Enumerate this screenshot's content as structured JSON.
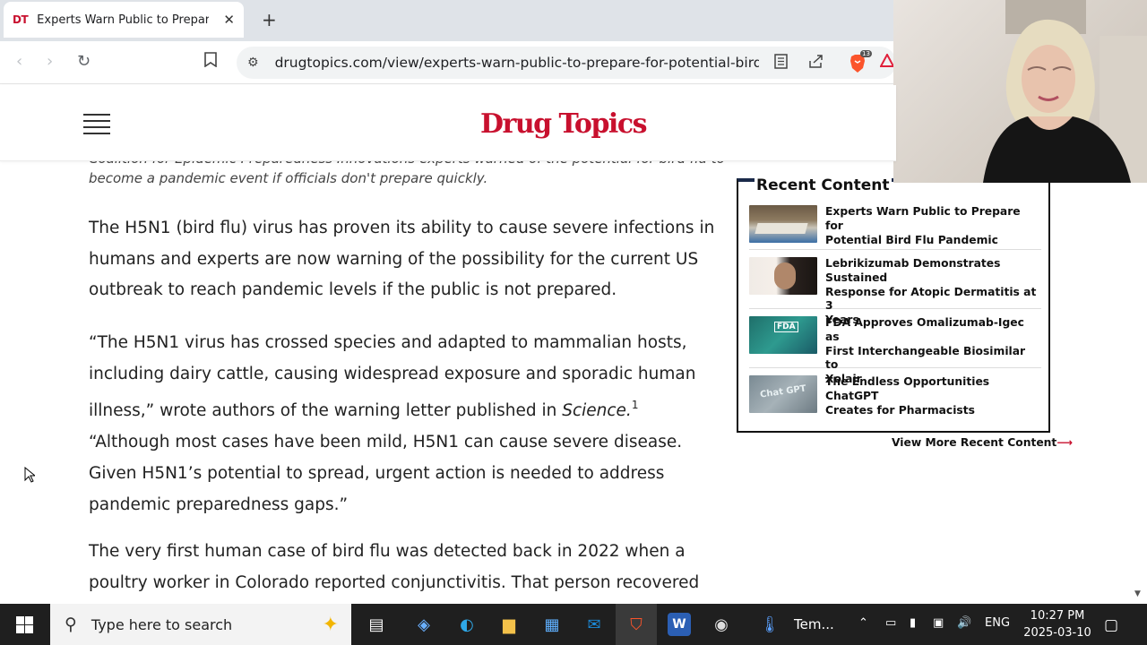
{
  "browser": {
    "tab_favicon": "DT",
    "tab_title": "Experts Warn Public to Prepare",
    "url": "drugtopics.com/view/experts-warn-public-to-prepare-for-potential-bird-...",
    "extension_badge": "13"
  },
  "site": {
    "logo": "Drug Topics"
  },
  "article": {
    "caption_cut": "Coalition for Epidemic Preparedness Innovations experts warned of the potential for bird flu to",
    "caption": "become a pandemic event if officials don't prepare quickly.",
    "paragraphs": [
      [
        "The H5N1 (bird flu) virus has proven its ability to cause severe infections in",
        "humans and experts are now warning of the possibility for the current US",
        "outbreak to reach pandemic levels if the public is not prepared."
      ],
      [
        "“The H5N1 virus has crossed species and adapted to mammalian hosts,",
        "including dairy cattle, causing widespread exposure and sporadic human",
        "illness,” wrote authors of the warning letter published in "
      ],
      [
        "“Although most cases have been mild, H5N1 can cause severe disease.",
        "Given H5N1’s potential to spread, urgent action is needed to address",
        "pandemic preparedness gaps.”"
      ],
      [
        "The very first human case of bird flu was detected back in 2022 when a",
        "poultry worker in Colorado reported conjunctivitis. That person recovered"
      ]
    ],
    "journal": "Science.",
    "ref": "1"
  },
  "recent": {
    "title": "Recent Content",
    "items": [
      {
        "title_lines": [
          "Experts Warn Public to Prepare for",
          "Potential Bird Flu Pandemic"
        ]
      },
      {
        "title_lines": [
          "Lebrikizumab Demonstrates Sustained",
          "Response for Atopic Dermatitis at 3",
          "Years"
        ]
      },
      {
        "title_lines": [
          "FDA Approves Omalizumab-Igec as",
          "First Interchangeable Biosimilar to",
          "Xolair"
        ],
        "thumb_label": "FDA"
      },
      {
        "title_lines": [
          "The Endless Opportunities ChatGPT",
          "Creates for Pharmacists"
        ],
        "thumb_label": "Chat GPT"
      }
    ],
    "view_more": "View More Recent Content",
    "view_more_arrow": "⟶"
  },
  "taskbar": {
    "search_placeholder": "Type here to search",
    "temp_label": "Tem...",
    "lang": "ENG",
    "time": "10:27 PM",
    "date": "2025-03-10"
  },
  "colors": {
    "brand_red": "#c8102e",
    "widget_border": "#111111",
    "taskbar": "#1f1f1f"
  }
}
